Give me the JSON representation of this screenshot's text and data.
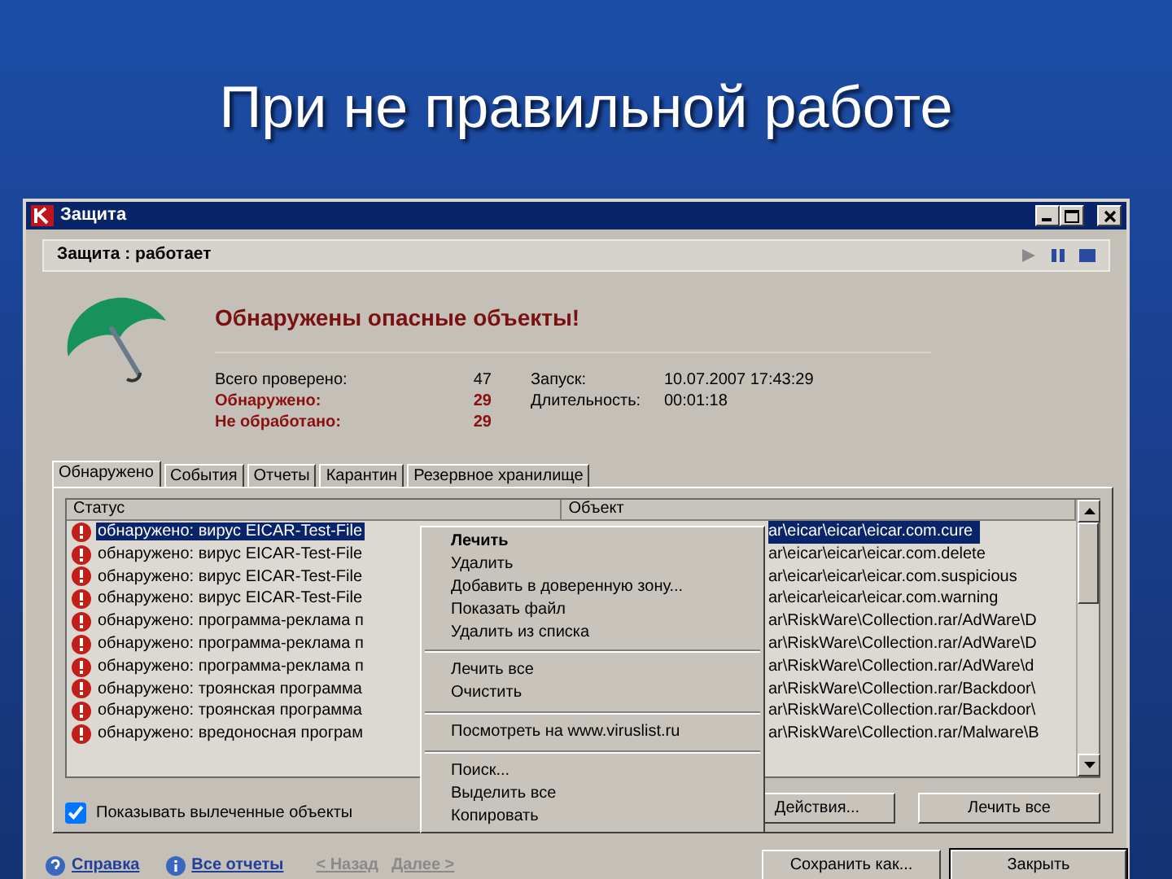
{
  "slide_title": "При не правильной работе",
  "window": {
    "title": "Защита"
  },
  "status_bar": {
    "text": "Защита : работает"
  },
  "alert": {
    "heading": "Обнаружены опасные объекты!"
  },
  "stats": [
    {
      "label": "Всего проверено:",
      "value": "47",
      "kind": "normal"
    },
    {
      "label": "Обнаружено:",
      "value": "29",
      "kind": "alert"
    },
    {
      "label": "Не обработано:",
      "value": "29",
      "kind": "alert"
    }
  ],
  "run_info": [
    {
      "label": "Запуск:",
      "value": "10.07.2007 17:43:29"
    },
    {
      "label": "Длительность:",
      "value": "00:01:18"
    }
  ],
  "tabs": [
    {
      "label": "Обнаружено",
      "selected": true
    },
    {
      "label": "События",
      "selected": false
    },
    {
      "label": "Отчеты",
      "selected": false
    },
    {
      "label": "Карантин",
      "selected": false
    },
    {
      "label": "Резервное хранилище",
      "selected": false
    }
  ],
  "table": {
    "columns": [
      "Статус",
      "Объект"
    ],
    "rows": [
      {
        "status": "обнаружено: вирус EICAR-Test-File",
        "object": "ar\\eicar\\eicar\\eicar.com.cure",
        "selected": true
      },
      {
        "status": "обнаружено: вирус EICAR-Test-File",
        "object": "ar\\eicar\\eicar\\eicar.com.delete",
        "selected": false
      },
      {
        "status": "обнаружено: вирус EICAR-Test-File",
        "object": "ar\\eicar\\eicar\\eicar.com.suspicious",
        "selected": false
      },
      {
        "status": "обнаружено: вирус EICAR-Test-File",
        "object": "ar\\eicar\\eicar\\eicar.com.warning",
        "selected": false
      },
      {
        "status": "обнаружено: программа-реклама п",
        "object": "ar\\RiskWare\\Collection.rar/AdWare\\D",
        "selected": false
      },
      {
        "status": "обнаружено: программа-реклама п",
        "object": "ar\\RiskWare\\Collection.rar/AdWare\\D",
        "selected": false
      },
      {
        "status": "обнаружено: программа-реклама п",
        "object": "ar\\RiskWare\\Collection.rar/AdWare\\d",
        "selected": false
      },
      {
        "status": "обнаружено: троянская программа",
        "object": "ar\\RiskWare\\Collection.rar/Backdoor\\",
        "selected": false
      },
      {
        "status": "обнаружено: троянская программа",
        "object": "ar\\RiskWare\\Collection.rar/Backdoor\\",
        "selected": false
      },
      {
        "status": "обнаружено: вредоносная програм",
        "object": "ar\\RiskWare\\Collection.rar/Malware\\B",
        "selected": false
      }
    ]
  },
  "context_menu": [
    {
      "kind": "item",
      "label": "Лечить",
      "bold": true
    },
    {
      "kind": "item",
      "label": "Удалить",
      "bold": false
    },
    {
      "kind": "item",
      "label": "Добавить в доверенную зону...",
      "bold": false
    },
    {
      "kind": "item",
      "label": "Показать файл",
      "bold": false
    },
    {
      "kind": "item",
      "label": "Удалить из списка",
      "bold": false
    },
    {
      "kind": "separator"
    },
    {
      "kind": "item",
      "label": "Лечить все",
      "bold": false
    },
    {
      "kind": "item",
      "label": "Очистить",
      "bold": false
    },
    {
      "kind": "separator"
    },
    {
      "kind": "item",
      "label": "Посмотреть на www.viruslist.ru",
      "bold": false
    },
    {
      "kind": "separator"
    },
    {
      "kind": "item",
      "label": "Поиск...",
      "bold": false
    },
    {
      "kind": "item",
      "label": "Выделить все",
      "bold": false
    },
    {
      "kind": "item",
      "label": "Копировать",
      "bold": false
    }
  ],
  "show_cured": {
    "label": "Показывать вылеченные объекты",
    "checked": true
  },
  "action_buttons": [
    "Действия...",
    "Лечить все"
  ],
  "footer_links": [
    {
      "label": "Справка",
      "kind": "help"
    },
    {
      "label": "Все отчеты",
      "kind": "info"
    }
  ],
  "nav_links": [
    {
      "label": "< Назад",
      "disabled": true
    },
    {
      "label": "Далее >",
      "disabled": true
    }
  ],
  "footer_buttons": [
    "Сохранить как...",
    "Закрыть"
  ]
}
